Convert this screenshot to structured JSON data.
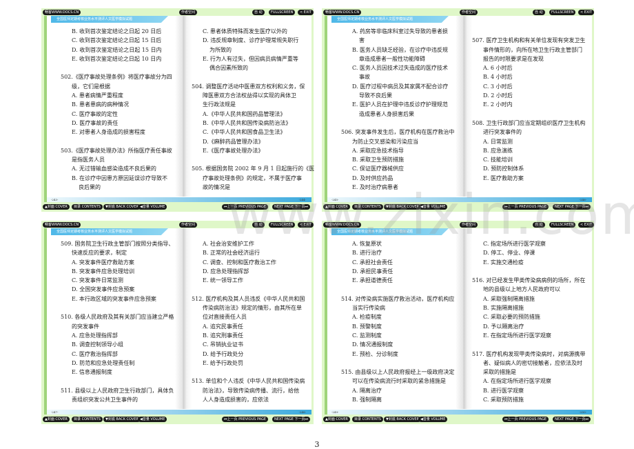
{
  "ui": {
    "brand": "畅客WWW.DOCS.CN",
    "author_site": "作者空间",
    "auto": "自 动",
    "fullscreen": "FULLSCREEN",
    "exit": "< EXIT",
    "header_strip": "全国医师定期考核业务水平测评人文医学模拟试题",
    "nav_cover": "▲封面 COVER",
    "nav_contents": "目录 CONTENTS",
    "nav_back_cover": "▼封底 BACK COVER",
    "nav_volume": "◀音量 VOLUME",
    "nav_prev": "⏮上一页 PREVIOUS PAGE",
    "nav_next": "NEXT PAGE 下一页⏭"
  },
  "colors": {
    "bar": "#dff7c8",
    "accent_blue": "#3aa9dd",
    "frame_green": "#9fd47a"
  },
  "sheet_page_number": "3",
  "watermark": "www.zixin.com.cn",
  "spreads": [
    {
      "left_num": "-243-",
      "right_num": "-244-",
      "left": [
        [
          "o",
          "B. 收到首次鉴定结论之日起 20 日后"
        ],
        [
          "o",
          "C. 收到首次鉴定结论之日起 15 日后"
        ],
        [
          "o",
          "D. 收到首次鉴定结论之日起 15 日内"
        ],
        [
          "o",
          "E. 收到首次鉴定结论之日起 10 日内"
        ],
        [
          "b",
          ""
        ],
        [
          "q",
          "502.《医疗事故处理条例》将医疗事故分为四"
        ],
        [
          "qc",
          "级，它们是根据"
        ],
        [
          "o",
          "A. 患者病情严重程度"
        ],
        [
          "o",
          "B. 患者患病的病种情况"
        ],
        [
          "o",
          "C. 医疗事故的定性"
        ],
        [
          "o",
          "D. 医疗事故的责任"
        ],
        [
          "o",
          "E. 对患者人身造成的损害程度"
        ],
        [
          "b",
          ""
        ],
        [
          "q",
          "503.《医疗事故处理办法》所指医疗责任事故"
        ],
        [
          "qc",
          "是指医务人员"
        ],
        [
          "o",
          "A. 无过错输血感染造成不良后果的"
        ],
        [
          "o",
          "B. 在诊疗中因患方原因延误诊疗导致不"
        ],
        [
          "oc",
          "良后果的"
        ]
      ],
      "right": [
        [
          "o",
          "C. 患者体质特殊而发生医疗以外的"
        ],
        [
          "o",
          "D. 违反规章制度、诊疗护理常规失职行"
        ],
        [
          "oc",
          "为所致的"
        ],
        [
          "o",
          "E. 行为人有过失，但因病员病情严重等"
        ],
        [
          "oc",
          "偶合因素所致的"
        ],
        [
          "b",
          ""
        ],
        [
          "q",
          "504. 调整医疗活动中医患双方权利和义务，保"
        ],
        [
          "qc",
          "障医患双方合法权益得以实现的具体卫"
        ],
        [
          "qc",
          "生行政法规是"
        ],
        [
          "o",
          "A.《中华人民共和国药品管理法》"
        ],
        [
          "o",
          "B.《中华人民共和国传染病防治法》"
        ],
        [
          "o",
          "C.《中华人民共和国食品卫生法》"
        ],
        [
          "o",
          "D.《麻醉药品管理办法》"
        ],
        [
          "o",
          "E.《医疗事故处理办法》"
        ],
        [
          "b",
          ""
        ],
        [
          "q",
          "505. 根据国务院 2002 年 9 月 1 日起施行的《医"
        ],
        [
          "qc",
          "疗事故处理条例》的规定，不属于医疗事"
        ],
        [
          "qc",
          "故的情况是"
        ]
      ]
    },
    {
      "left_num": "-245-",
      "right_num": "-246-",
      "left": [
        [
          "o",
          "A. 药房等非临床科室过失导致的患者损"
        ],
        [
          "oc",
          "害"
        ],
        [
          "o",
          "B. 医务人员缺乏经验，在诊疗中违反规"
        ],
        [
          "oc",
          "章造成患者一般性功能障碍"
        ],
        [
          "o",
          "C. 医务人员因技术过失造成的医疗技术"
        ],
        [
          "oc",
          "事故"
        ],
        [
          "o",
          "D. 医疗过程中病员及其家属不配合诊疗"
        ],
        [
          "oc",
          "导致不良后果"
        ],
        [
          "o",
          "E. 医护人员在护理中违反诊疗护理规范"
        ],
        [
          "oc",
          "造成患者人身损害后果"
        ],
        [
          "b",
          ""
        ],
        [
          "q",
          "506. 突发事件发生后，医疗机构在医疗救治中"
        ],
        [
          "qc",
          "为防止交叉感染和污染应当"
        ],
        [
          "o",
          "A. 采取应急技术指导"
        ],
        [
          "o",
          "B. 采取卫生预防措施"
        ],
        [
          "o",
          "C. 保证医疗器械供应"
        ],
        [
          "o",
          "D. 及时供应药品"
        ],
        [
          "o",
          "E. 及时治疗病患者"
        ]
      ],
      "right": [
        [
          "b",
          ""
        ],
        [
          "q",
          "507. 医疗卫生机构和有关单位发现有突发卫生"
        ],
        [
          "qc",
          "事件情形的，向所在地卫生行政主管部门"
        ],
        [
          "qc",
          "报告的时限要求是在发现"
        ],
        [
          "o",
          "A. 6 小时后"
        ],
        [
          "o",
          "B. 4 小时后"
        ],
        [
          "o",
          "C. 3 小时后"
        ],
        [
          "o",
          "D. 2 小时后"
        ],
        [
          "o",
          "E. 2 小时内"
        ],
        [
          "b",
          ""
        ],
        [
          "q",
          "508. 卫生行政部门应当定期组织医疗卫生机构"
        ],
        [
          "qc",
          "进行突发事件的"
        ],
        [
          "o",
          "A. 日常监测"
        ],
        [
          "o",
          "B. 应急演练"
        ],
        [
          "o",
          "C. 技能培训"
        ],
        [
          "o",
          "D. 预防控制体系"
        ],
        [
          "o",
          "E. 医疗救助方案"
        ]
      ]
    },
    {
      "left_num": "-247-",
      "right_num": "-248-",
      "left": [
        [
          "q",
          "509. 国务院卫生行政主管部门按照分类指导、"
        ],
        [
          "qc",
          "快速反应的要求，制定"
        ],
        [
          "o",
          "A. 突发事件医疗救助方案"
        ],
        [
          "o",
          "B. 突发事件应急处理培训"
        ],
        [
          "o",
          "C. 突发事件日常监测"
        ],
        [
          "o",
          "D. 全国突发事件应急预案"
        ],
        [
          "o",
          "E. 本行政区域的突发事件应急预案"
        ],
        [
          "b",
          ""
        ],
        [
          "q",
          "510. 各级人民政府及其有关部门应当建立严格"
        ],
        [
          "qc",
          "的突发事件"
        ],
        [
          "o",
          "A. 应急处理指挥部"
        ],
        [
          "o",
          "B. 调查控制领导小组"
        ],
        [
          "o",
          "C. 医疗救治指挥部"
        ],
        [
          "o",
          "D. 防范和应急处理责任制"
        ],
        [
          "o",
          "E. 信息通报制度"
        ],
        [
          "b",
          ""
        ],
        [
          "q",
          "511. 县级以上人民政府卫生行政部门，具体负"
        ],
        [
          "qc",
          "责组织突发公共卫生事件的"
        ]
      ],
      "right": [
        [
          "o",
          "A. 社会治安维护工作"
        ],
        [
          "o",
          "B. 正常的社会经济运行"
        ],
        [
          "o",
          "C. 调查、控制和医疗救治工作"
        ],
        [
          "o",
          "D. 应急处理指挥部"
        ],
        [
          "o",
          "E. 统一领导工作"
        ],
        [
          "b",
          ""
        ],
        [
          "q",
          "512. 医疗机构及其人员违反《中华人民共和国"
        ],
        [
          "qc",
          "传染病防治法》规定的情形，由其所在单"
        ],
        [
          "qc",
          "位对直接责任人员"
        ],
        [
          "o",
          "A. 追究民事责任"
        ],
        [
          "o",
          "B. 追究刑事责任"
        ],
        [
          "o",
          "C. 吊销执业证书"
        ],
        [
          "o",
          "D. 给予行政处分"
        ],
        [
          "o",
          "E. 给予行政处罚"
        ],
        [
          "b",
          ""
        ],
        [
          "q",
          "513. 单位和个人违反《中华人民共和国传染病"
        ],
        [
          "qc",
          "防治法》，导致传染病传播、流行，给他"
        ],
        [
          "qc",
          "人人身造成损害的，应依法"
        ]
      ]
    },
    {
      "left_num": "-249-",
      "right_num": "-250-",
      "left": [
        [
          "o",
          "A. 恢复原状"
        ],
        [
          "o",
          "B. 进行治疗"
        ],
        [
          "o",
          "C. 承担社会责任"
        ],
        [
          "o",
          "D. 承担民事责任"
        ],
        [
          "o",
          "E. 承担道德责任"
        ],
        [
          "b",
          ""
        ],
        [
          "q",
          "514. 对传染病实施医疗救治活动，医疗机构应"
        ],
        [
          "qc",
          "当实行传染病"
        ],
        [
          "o",
          "A. 检疫制度"
        ],
        [
          "o",
          "B. 预警制度"
        ],
        [
          "o",
          "C. 监测制度"
        ],
        [
          "o",
          "D. 情况通报制度"
        ],
        [
          "o",
          "E. 预检、分诊制度"
        ],
        [
          "b",
          ""
        ],
        [
          "q",
          "515. 由县级以上人民政府报经上一级政府决定"
        ],
        [
          "qc",
          "可以在传染病流行时采取的紧急措施是"
        ],
        [
          "o",
          "A. 隔离治疗"
        ],
        [
          "o",
          "B. 强制隔离"
        ]
      ],
      "right": [
        [
          "o",
          "C. 指定场所进行医学观察"
        ],
        [
          "o",
          "D. 停工、停业、停课"
        ],
        [
          "o",
          "E. 实施交通检疫"
        ],
        [
          "b",
          ""
        ],
        [
          "q",
          "516. 对已经发生甲类传染病病例的场所，所在"
        ],
        [
          "qc",
          "地的县级以上地方人民政府可以"
        ],
        [
          "o",
          "A. 采取强制隔离措施"
        ],
        [
          "o",
          "B. 实施隔离措施"
        ],
        [
          "o",
          "C. 采取必要的预防措施"
        ],
        [
          "o",
          "D. 予以隔离治疗"
        ],
        [
          "o",
          "E. 在指定场所进行医学观察"
        ],
        [
          "b",
          ""
        ],
        [
          "q",
          "517. 医疗机构发现甲类传染病时，对病源携带"
        ],
        [
          "qc",
          "者、疑似病人的密切接触者，应依法及时"
        ],
        [
          "qc",
          "采取的措施是"
        ],
        [
          "o",
          "A. 在指定场所进行医学观察"
        ],
        [
          "o",
          "B. 进行医学观察"
        ],
        [
          "o",
          "C. 采取预防措施"
        ]
      ]
    }
  ]
}
